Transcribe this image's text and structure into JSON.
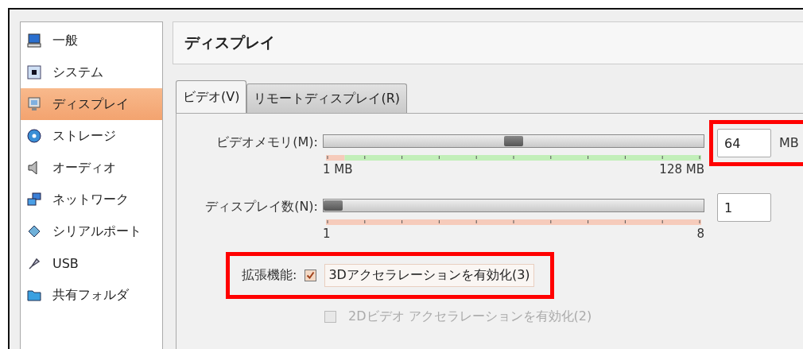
{
  "sidebar": {
    "items": [
      {
        "label": "一般",
        "selected": false
      },
      {
        "label": "システム",
        "selected": false
      },
      {
        "label": "ディスプレイ",
        "selected": true
      },
      {
        "label": "ストレージ",
        "selected": false
      },
      {
        "label": "オーディオ",
        "selected": false
      },
      {
        "label": "ネットワーク",
        "selected": false
      },
      {
        "label": "シリアルポート",
        "selected": false
      },
      {
        "label": "USB",
        "selected": false
      },
      {
        "label": "共有フォルダ",
        "selected": false
      }
    ]
  },
  "header": {
    "title": "ディスプレイ"
  },
  "tabs": [
    {
      "label": "ビデオ(V)",
      "selected": true
    },
    {
      "label": "リモートディスプレイ(R)",
      "selected": false
    }
  ],
  "sliders": [
    {
      "label": "ビデオメモリ(M):",
      "level": 0.5,
      "min_label": "1 MB",
      "max_label": "128 MB",
      "value": "64",
      "unit": "MB",
      "highlighted": true,
      "scale": [
        {
          "color": "#f6cbbb",
          "level": 0.05
        },
        {
          "color": "#c2efb9",
          "level": 0.95
        }
      ]
    },
    {
      "label": "ディスプレイ数(N):",
      "level": 0,
      "min_label": "1",
      "max_label": "8",
      "value": "1",
      "highlighted": false,
      "scale": [
        {
          "color": "#f6cbbb",
          "level": 1
        }
      ]
    }
  ],
  "extensions": {
    "label": "拡張機能:",
    "highlighted": true,
    "options": [
      {
        "label": "3Dアクセラレーションを有効化(3)",
        "checked": true,
        "disabled": false,
        "focused": true
      },
      {
        "label": "2Dビデオ アクセラレーションを有効化(2)",
        "checked": false,
        "disabled": true,
        "focused": false
      }
    ]
  }
}
